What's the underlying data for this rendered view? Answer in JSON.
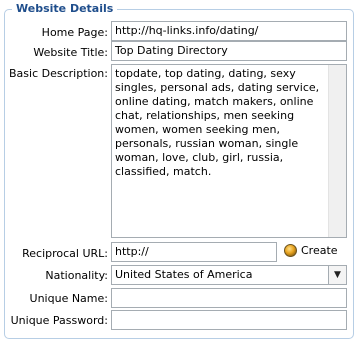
{
  "section": {
    "title": "Website Details"
  },
  "fields": {
    "home_page": {
      "label": "Home Page:",
      "value": "http://hq-links.info/dating/"
    },
    "website_title": {
      "label": "Website Title:",
      "value": "Top Dating Directory"
    },
    "description": {
      "label": "Basic Description:",
      "value": "topdate, top dating, dating, sexy singles, personal ads, dating service, online dating, match makers, online chat, relationships, men seeking women, women seeking men, personals, russian woman, single woman, love, club, girl, russia, classified, match."
    },
    "reciprocal_url": {
      "label": "Reciprocal URL:",
      "value": "http://",
      "create_label": "Create",
      "create_icon": "globe-icon"
    },
    "nationality": {
      "label": "Nationality:",
      "value": "United States of America",
      "dropdown_icon": "chevron-down-icon"
    },
    "unique_name": {
      "label": "Unique Name:",
      "value": ""
    },
    "unique_password": {
      "label": "Unique Password:",
      "value": ""
    }
  }
}
